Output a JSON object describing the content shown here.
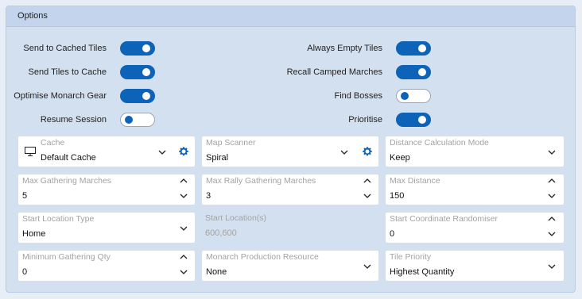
{
  "panel": {
    "title": "Options"
  },
  "toggles": {
    "send_to_cached_tiles": {
      "label": "Send to Cached Tiles",
      "on": true
    },
    "send_tiles_to_cache": {
      "label": "Send Tiles to Cache",
      "on": true
    },
    "optimise_monarch_gear": {
      "label": "Optimise Monarch Gear",
      "on": true
    },
    "resume_session": {
      "label": "Resume Session",
      "on": false
    },
    "always_empty_tiles": {
      "label": "Always Empty Tiles",
      "on": true
    },
    "recall_camped_marches": {
      "label": "Recall Camped Marches",
      "on": true
    },
    "find_bosses": {
      "label": "Find Bosses",
      "on": false
    },
    "prioritise": {
      "label": "Prioritise",
      "on": true
    }
  },
  "fields": {
    "cache": {
      "caption": "Cache",
      "value": "Default Cache"
    },
    "map_scanner": {
      "caption": "Map Scanner",
      "value": "Spiral"
    },
    "distance_calculation_mode": {
      "caption": "Distance Calculation Mode",
      "value": "Keep"
    },
    "max_gathering_marches": {
      "caption": "Max Gathering Marches",
      "value": "5"
    },
    "max_rally_gathering_marches": {
      "caption": "Max Rally Gathering Marches",
      "value": "3"
    },
    "max_distance": {
      "caption": "Max Distance",
      "value": "150"
    },
    "start_location_type": {
      "caption": "Start Location Type",
      "value": "Home"
    },
    "start_locations": {
      "caption": "Start Location(s)",
      "value": "600,600"
    },
    "start_coordinate_randomiser": {
      "caption": "Start Coordinate Randomiser",
      "value": "0"
    },
    "minimum_gathering_qty": {
      "caption": "Minimum Gathering Qty",
      "value": "0"
    },
    "monarch_production_resource": {
      "caption": "Monarch Production Resource",
      "value": "None"
    },
    "tile_priority": {
      "caption": "Tile Priority",
      "value": "Highest Quantity"
    }
  },
  "icons": {
    "cache_icon": "monitor-icon",
    "settings_icon": "gear-icon",
    "dropdown_icon": "chevron-down-icon",
    "increment_icon": "chevron-up-icon"
  },
  "colors": {
    "accent": "#0c63b8",
    "panel_background": "#d3e0f0",
    "header_background": "#c3d4ec",
    "caption_text": "#a3a3a3"
  }
}
